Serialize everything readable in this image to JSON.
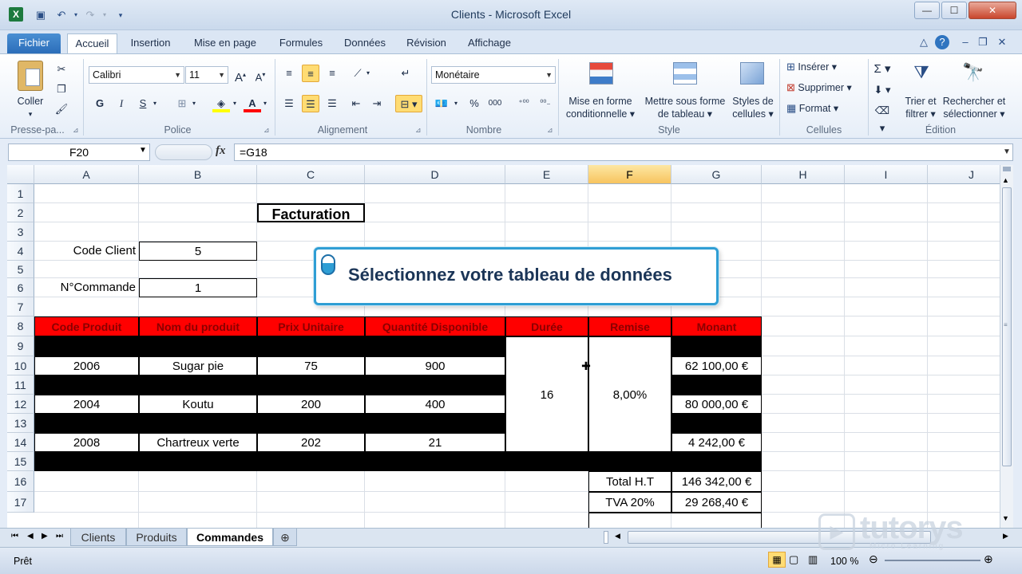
{
  "window": {
    "title": "Clients  -  Microsoft Excel"
  },
  "ribbon_tabs": [
    "Fichier",
    "Accueil",
    "Insertion",
    "Mise en page",
    "Formules",
    "Données",
    "Révision",
    "Affichage"
  ],
  "ribbon": {
    "paste_label": "Coller",
    "font_name": "Calibri",
    "font_size": "11",
    "number_format": "Monétaire",
    "bold": "G",
    "italic": "I",
    "underline": "S",
    "cond_format": [
      "Mise en forme",
      "conditionnelle ▾"
    ],
    "format_table": [
      "Mettre sous forme",
      "de tableau ▾"
    ],
    "cell_styles": [
      "Styles de",
      "cellules ▾"
    ],
    "insert": "Insérer ▾",
    "delete": "Supprimer ▾",
    "format": "Format ▾",
    "sort_filter": [
      "Trier et",
      "filtrer ▾"
    ],
    "find_select": [
      "Rechercher et",
      "sélectionner ▾"
    ],
    "groups": {
      "clipboard": "Presse-pa...",
      "font": "Police",
      "alignment": "Alignement",
      "number": "Nombre",
      "style": "Style",
      "cells": "Cellules",
      "editing": "Édition"
    }
  },
  "formula_bar": {
    "name_box": "F20",
    "fx": "fx",
    "formula": "=G18"
  },
  "columns": [
    "A",
    "B",
    "C",
    "D",
    "E",
    "F",
    "G",
    "H",
    "I",
    "J"
  ],
  "rows": [
    "1",
    "2",
    "3",
    "4",
    "5",
    "6",
    "7",
    "8",
    "9",
    "10",
    "11",
    "12",
    "13",
    "14",
    "15",
    "16",
    "17"
  ],
  "cells": {
    "title": "Facturation",
    "code_client_label": "Code Client",
    "code_client_value": "5",
    "commande_label": "N°Commande",
    "commande_value": "1",
    "headers": [
      "Code Produit",
      "Nom du produit",
      "Prix Unitaire",
      "Quantité Disponible",
      "Durée",
      "Remise",
      "Monant"
    ],
    "items": [
      {
        "code": "2006",
        "name": "Sugar pie",
        "price": "75",
        "qty": "900",
        "total": "62 100,00 €"
      },
      {
        "code": "2004",
        "name": "Koutu",
        "price": "200",
        "qty": "400",
        "total": "80 000,00 €"
      },
      {
        "code": "2008",
        "name": "Chartreux verte",
        "price": "202",
        "qty": "21",
        "total": "4 242,00 €"
      }
    ],
    "duree": "16",
    "remise": "8,00%",
    "total_ht_label": "Total H.T",
    "total_ht": "146 342,00 €",
    "tva_label": "TVA 20%",
    "tva": "29 268,40 €"
  },
  "callout": {
    "text": "Sélectionnez votre tableau de données"
  },
  "sheet_tabs": [
    "Clients",
    "Produits",
    "Commandes"
  ],
  "status": {
    "ready": "Prêt",
    "zoom": "100 %"
  },
  "watermark": {
    "brand": "tutorys",
    "tagline": "Micro Learning"
  },
  "colors": {
    "header_red": "#ff0000",
    "header_text": "#8b0000",
    "callout_border": "#2f9ed4",
    "selected_col": "#f7c45f"
  }
}
